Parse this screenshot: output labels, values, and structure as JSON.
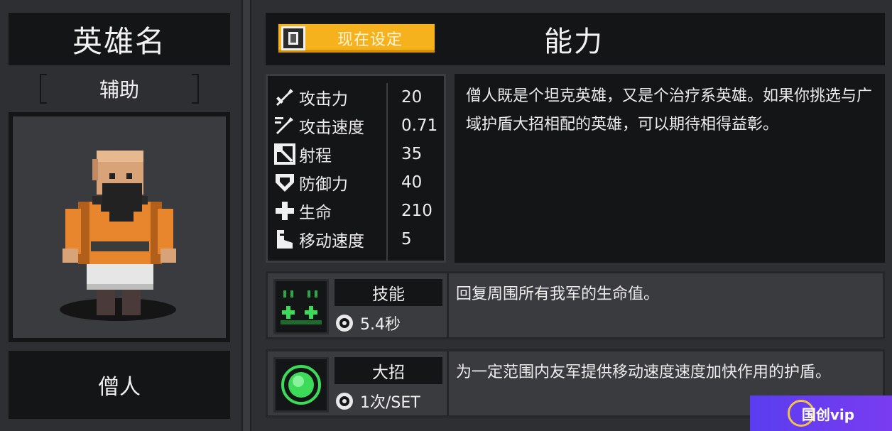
{
  "hero": {
    "name_title": "英雄名",
    "role": "辅助",
    "type": "僧人"
  },
  "header": {
    "set_button_label": "现在设定",
    "section_title": "能力"
  },
  "stats": [
    {
      "icon": "sword-icon",
      "label": "攻击力",
      "value": "20"
    },
    {
      "icon": "attack-speed-icon",
      "label": "攻击速度",
      "value": "0.71"
    },
    {
      "icon": "range-icon",
      "label": "射程",
      "value": "35"
    },
    {
      "icon": "shield-icon",
      "label": "防御力",
      "value": "40"
    },
    {
      "icon": "health-cross-icon",
      "label": "生命",
      "value": "210"
    },
    {
      "icon": "boot-icon",
      "label": "移动速度",
      "value": "5"
    }
  ],
  "description": "僧人既是个坦克英雄，又是个治疗系英雄。如果你挑选与广域护盾大招相配的英雄，可以期待相得益彰。",
  "skill": {
    "name": "技能",
    "cooldown": "5.4秒",
    "description": "回复周围所有我军的生命值。"
  },
  "ultimate": {
    "name": "大招",
    "cooldown": "1次/SET",
    "description": "为一定范围内友军提供移动速度速度加快作用的护盾。"
  },
  "watermark": "国创vip",
  "colors": {
    "background": "#2e2f33",
    "panel": "#141517",
    "button_yellow": "#f5b21c",
    "skill_green": "#3ddc58"
  }
}
